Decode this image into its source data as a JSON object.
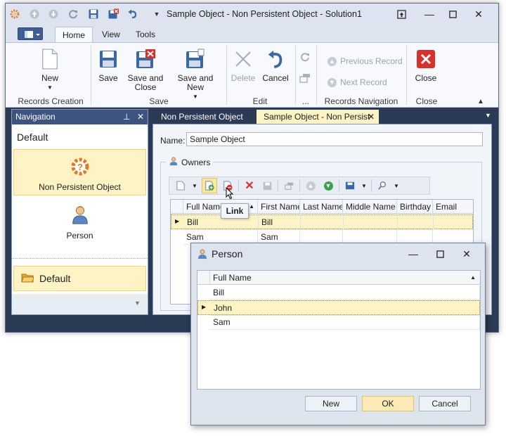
{
  "window": {
    "title": "Sample Object - Non Persistent Object - Solution1"
  },
  "ribbon": {
    "tabs": [
      {
        "label": "Home",
        "active": true
      },
      {
        "label": "View",
        "active": false
      },
      {
        "label": "Tools",
        "active": false
      }
    ],
    "groups": {
      "records_creation": {
        "label": "Records Creation",
        "new_label": "New"
      },
      "save": {
        "label": "Save",
        "save_label": "Save",
        "save_close_line1": "Save and",
        "save_close_line2": "Close",
        "save_new_label": "Save and New"
      },
      "edit": {
        "label": "Edit",
        "delete_label": "Delete",
        "cancel_label": "Cancel"
      },
      "more": {
        "label": "..."
      },
      "records_navigation": {
        "label": "Records Navigation",
        "previous_label": "Previous Record",
        "next_label": "Next Record"
      },
      "close": {
        "label": "Close",
        "close_label": "Close"
      }
    }
  },
  "navigation": {
    "header": "Navigation",
    "group_title": "Default",
    "items": [
      {
        "label": "Non Persistent Object",
        "selected": true,
        "icon": "question-gear-icon"
      },
      {
        "label": "Person",
        "selected": false,
        "icon": "person-icon"
      }
    ],
    "bottom_group": "Default"
  },
  "document": {
    "tabs": [
      {
        "label": "Non Persistent Object",
        "active": false
      },
      {
        "label": "Sample Object - Non Persist",
        "active": true
      }
    ],
    "name_label": "Name:",
    "name_value": "Sample Object",
    "owners_label": "Owners",
    "tooltip": "Link",
    "grid": {
      "columns": [
        "Full Name",
        "First Name",
        "Last Name",
        "Middle Name",
        "Birthday",
        "Email"
      ],
      "rows": [
        {
          "full_name": "Bill",
          "first_name": "Bill",
          "selected": true
        },
        {
          "full_name": "Sam",
          "first_name": "Sam",
          "selected": false
        }
      ]
    }
  },
  "dialog": {
    "title": "Person",
    "column": "Full Name",
    "rows": [
      {
        "name": "Bill",
        "selected": false
      },
      {
        "name": "John",
        "selected": true
      },
      {
        "name": "Sam",
        "selected": false
      }
    ],
    "buttons": {
      "new": "New",
      "ok": "OK",
      "cancel": "Cancel"
    }
  },
  "colors": {
    "accent_dark": "#2b3a55",
    "selection": "#fdf3c4",
    "close_red": "#d9302c"
  }
}
